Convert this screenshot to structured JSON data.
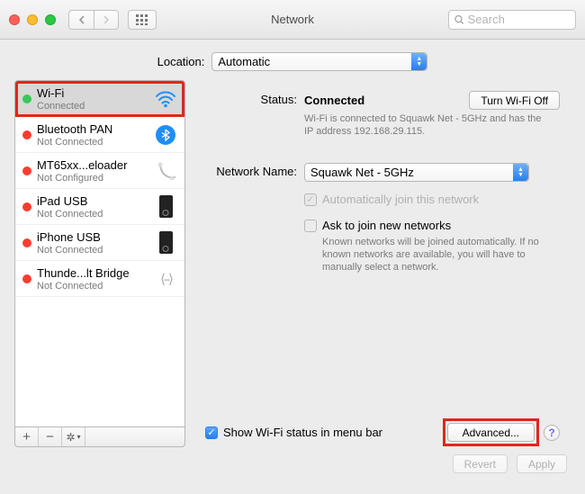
{
  "window": {
    "title": "Network"
  },
  "search": {
    "placeholder": "Search"
  },
  "location": {
    "label": "Location:",
    "value": "Automatic"
  },
  "sidebar": {
    "items": [
      {
        "title": "Wi-Fi",
        "sub": "Connected",
        "status": "green",
        "icon": "wifi"
      },
      {
        "title": "Bluetooth PAN",
        "sub": "Not Connected",
        "status": "red",
        "icon": "bluetooth"
      },
      {
        "title": "MT65xx...eloader",
        "sub": "Not Configured",
        "status": "red",
        "icon": "phone"
      },
      {
        "title": "iPad USB",
        "sub": "Not Connected",
        "status": "red",
        "icon": "device"
      },
      {
        "title": "iPhone USB",
        "sub": "Not Connected",
        "status": "red",
        "icon": "device"
      },
      {
        "title": "Thunde...lt Bridge",
        "sub": "Not Connected",
        "status": "red",
        "icon": "thunderbolt"
      }
    ]
  },
  "main": {
    "status_label": "Status:",
    "status_value": "Connected",
    "toggle_button": "Turn Wi-Fi Off",
    "status_desc": "Wi-Fi is connected to Squawk Net - 5GHz and has the IP address 192.168.29.115.",
    "network_name_label": "Network Name:",
    "network_name_value": "Squawk Net - 5GHz",
    "auto_join": "Automatically join this network",
    "ask_join": "Ask to join new networks",
    "ask_join_desc": "Known networks will be joined automatically. If no known networks are available, you will have to manually select a network.",
    "show_status": "Show Wi-Fi status in menu bar",
    "advanced": "Advanced...",
    "help": "?"
  },
  "footer": {
    "revert": "Revert",
    "apply": "Apply"
  }
}
